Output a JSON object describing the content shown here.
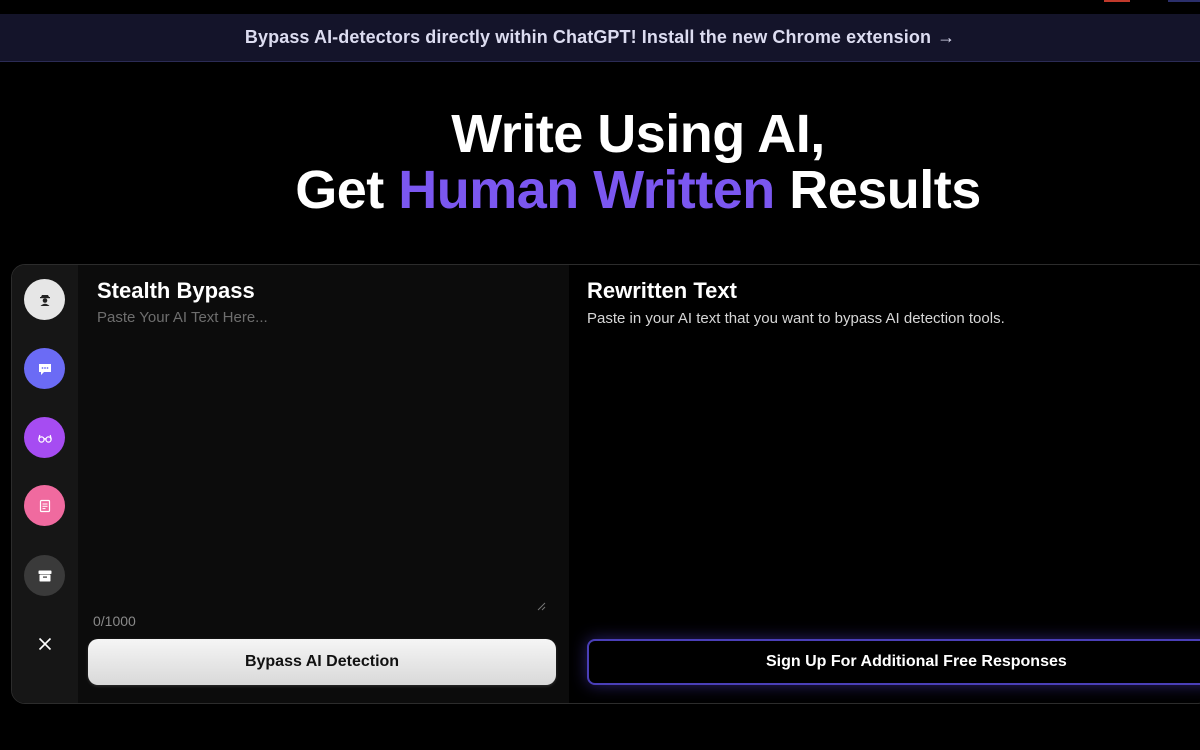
{
  "banner": {
    "text": "Bypass AI-detectors directly within ChatGPT! Install the new Chrome extension",
    "arrow": "→"
  },
  "hero": {
    "line1": "Write Using AI,",
    "line2_prefix": "Get ",
    "line2_accent": "Human Written",
    "line2_suffix": " Results",
    "accent_color": "#7b57f0"
  },
  "sidebar": {
    "items": [
      {
        "icon": "stealth-icon",
        "color": "#e6e6e6"
      },
      {
        "icon": "chat-icon",
        "color": "#6b6bf5"
      },
      {
        "icon": "glasses-icon",
        "color": "#a64cf2"
      },
      {
        "icon": "document-icon",
        "color": "#f06a9f"
      },
      {
        "icon": "archive-icon",
        "color": "#3a3a3a"
      },
      {
        "icon": "close-icon",
        "color": "transparent"
      }
    ]
  },
  "input_panel": {
    "title": "Stealth Bypass",
    "placeholder": "Paste Your AI Text Here...",
    "value": "",
    "char_count": "0/1000",
    "button_label": "Bypass AI Detection"
  },
  "output_panel": {
    "title": "Rewritten Text",
    "description": "Paste in your AI text that you want to bypass AI detection tools.",
    "button_label": "Sign Up For Additional Free Responses"
  }
}
